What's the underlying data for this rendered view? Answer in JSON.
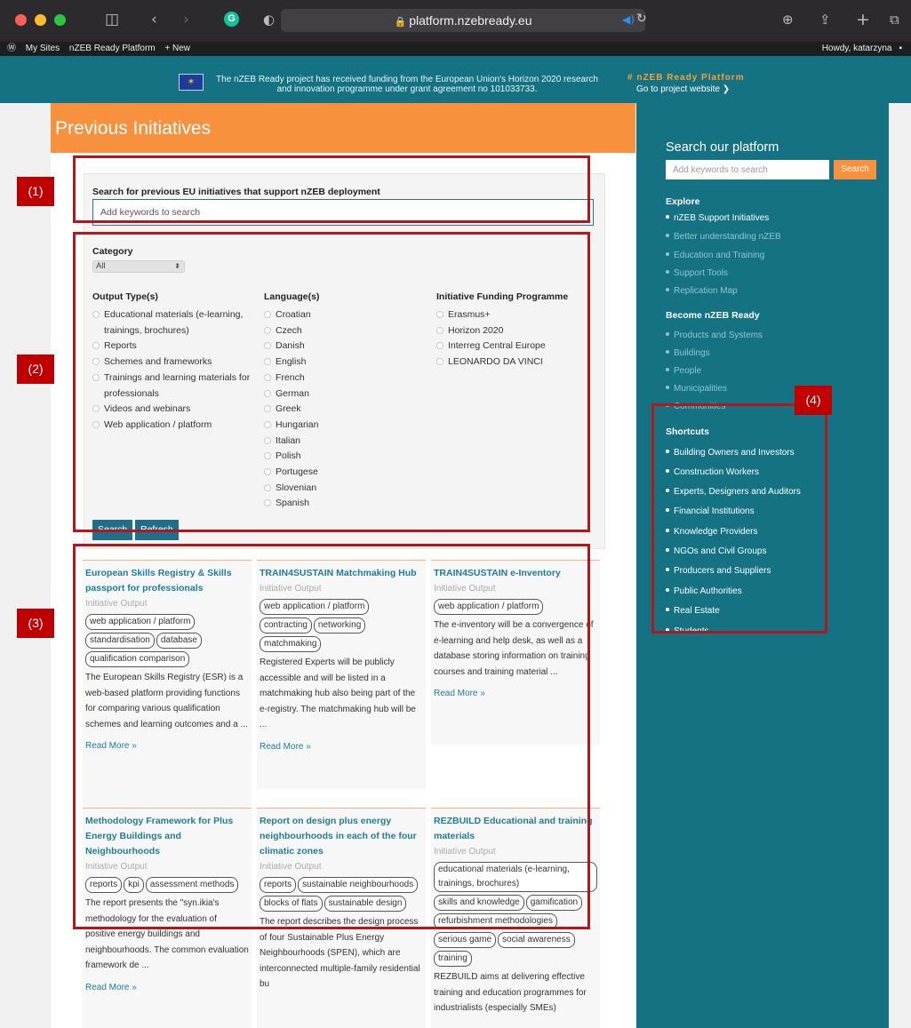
{
  "browser": {
    "url": "platform.nzebready.eu",
    "traffic_lights": [
      "#ff5f56",
      "#ffbd2e",
      "#27c93f"
    ],
    "grammarly_letter": "G"
  },
  "wp_admin_bar": {
    "items": [
      "My Sites",
      "nZEB Ready Platform",
      "+ New"
    ],
    "greeting": "Howdy, katarzyna"
  },
  "banner": {
    "funding_text": "The nZEB Ready project has received funding from the European Union's Horizon 2020 research and innovation programme under grant agreement no 101033733.",
    "brand": "# nZEB Ready Platform",
    "project_link": "Go to project website ❯"
  },
  "main": {
    "page_title": "Previous Initiatives",
    "search_label": "Search for previous EU initiatives that support nZEB deployment",
    "search_placeholder": "Add keywords to search",
    "category_label": "Category",
    "category_value": "All",
    "facets": [
      {
        "title": "Output Type(s)",
        "options": [
          "Educational materials (e-learning, trainings, brochures)",
          "Reports",
          "Schemes and frameworks",
          "Trainings and learning materials for professionals",
          "Videos and webinars",
          "Web application / platform"
        ]
      },
      {
        "title": "Language(s)",
        "options": [
          "Croatian",
          "Czech",
          "Danish",
          "English",
          "French",
          "German",
          "Greek",
          "Hungarian",
          "Italian",
          "Polish",
          "Portugese",
          "Slovenian",
          "Spanish"
        ]
      },
      {
        "title": "Initiative Funding Programme",
        "options": [
          "Erasmus+",
          "Horizon 2020",
          "Interreg Central Europe",
          "LEONARDO DA VINCI"
        ]
      }
    ],
    "search_button": "Search",
    "refresh_button": "Refresh",
    "cards": [
      {
        "title": "European Skills Registry & Skills passport for professionals",
        "subtitle": "Initiative Output",
        "tags": [
          "web application / platform",
          "standardisation",
          "database",
          "qualification comparison"
        ],
        "description": "The European Skills Registry (ESR) is a web-based platform providing functions for comparing various qualification schemes and learning outcomes and a ...",
        "more": "Read More »"
      },
      {
        "title": "TRAIN4SUSTAIN Matchmaking Hub",
        "subtitle": "Initiative Output",
        "tags": [
          "web application / platform",
          "contracting",
          "networking",
          "matchmaking"
        ],
        "description": "Registered Experts will be publicly accessible and will be listed in a matchmaking hub also being part of the e-registry. The matchmaking hub will be ...",
        "more": "Read More »"
      },
      {
        "title": "TRAIN4SUSTAIN e-Inventory",
        "subtitle": "Initiative Output",
        "tags": [
          "web application / platform"
        ],
        "description": "The e-inventory will be a convergence of e-learning and help desk, as well as a database storing information on training courses and training material ...",
        "more": "Read More »"
      },
      {
        "title": "Methodology Framework for Plus Energy Buildings and Neighbourhoods",
        "subtitle": "Initiative Output",
        "tags": [
          "reports",
          "kpi",
          "assessment methods"
        ],
        "description": "The report presents the \"syn.ikia's methodology for the evaluation of positive energy buildings and neighbourhoods. The common evaluation framework de ...",
        "more": "Read More »"
      },
      {
        "title": "Report on design plus energy neighbourhoods in each of the four climatic zones",
        "subtitle": "Initiative Output",
        "tags": [
          "reports",
          "sustainable neighbourhoods",
          "blocks of flats",
          "sustainable design"
        ],
        "description": "The report describes the design process of four Sustainable Plus Energy Neighbourhoods (SPEN), which are interconnected multiple-family residential bu",
        "more": ""
      },
      {
        "title": "REZBUILD Educational and training materials",
        "subtitle": "Initiative Output",
        "tags": [
          "educational materials (e-learning, trainings, brochures)",
          "skills and knowledge",
          "gamification",
          "refurbishment methodologies",
          "serious game",
          "social awareness",
          "training"
        ],
        "description": "REZBUILD aims at delivering effective training and education programmes for industrialists (especially SMEs)",
        "more": ""
      }
    ]
  },
  "sidebar": {
    "search_heading": "Search our platform",
    "search_placeholder": "Add keywords to search",
    "search_button": "Search",
    "explore_title": "Explore",
    "explore_items": [
      "nZEB Support Initiatives",
      "Better understanding nZEB",
      "Education and Training",
      "Support Tools",
      "Replication Map"
    ],
    "become_title": "Become nZEB Ready",
    "become_items": [
      "Products and Systems",
      "Buildings",
      "People",
      "Municipalities",
      "Communities"
    ],
    "shortcuts_title": "Shortcuts",
    "shortcut_items": [
      "Building Owners and Investors",
      "Construction Workers",
      "Experts, Designers and Auditors",
      "Financial Institutions",
      "Knowledge Providers",
      "NGOs and Civil Groups",
      "Producers and Suppliers",
      "Public Authorities",
      "Real Estate",
      "Students"
    ]
  },
  "annotations": [
    "(1)",
    "(2)",
    "(3)",
    "(4)"
  ],
  "colors": {
    "teal": "#147283",
    "orange": "#f8913e",
    "link": "#1f7d96",
    "annotation_red": "#c00000"
  }
}
